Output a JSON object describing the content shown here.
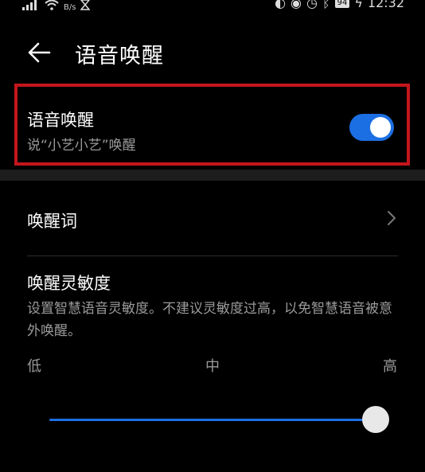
{
  "status_bar": {
    "net_speed": "B/s",
    "battery": "94",
    "time": "12:32"
  },
  "header": {
    "title": "语音唤醒"
  },
  "voice_wake": {
    "title": "语音唤醒",
    "subtitle": "说“小艺小艺”唤醒",
    "enabled": true
  },
  "wake_word": {
    "label": "唤醒词"
  },
  "sensitivity": {
    "title": "唤醒灵敏度",
    "description": "设置智慧语音灵敏度。不建议灵敏度过高，以免智慧语音被意外唤醒。",
    "ticks": [
      "低",
      "中",
      "高"
    ],
    "value": 1.0
  },
  "colors": {
    "accent": "#1c6fe2",
    "highlight_border": "#c4161c",
    "background": "#000000"
  }
}
